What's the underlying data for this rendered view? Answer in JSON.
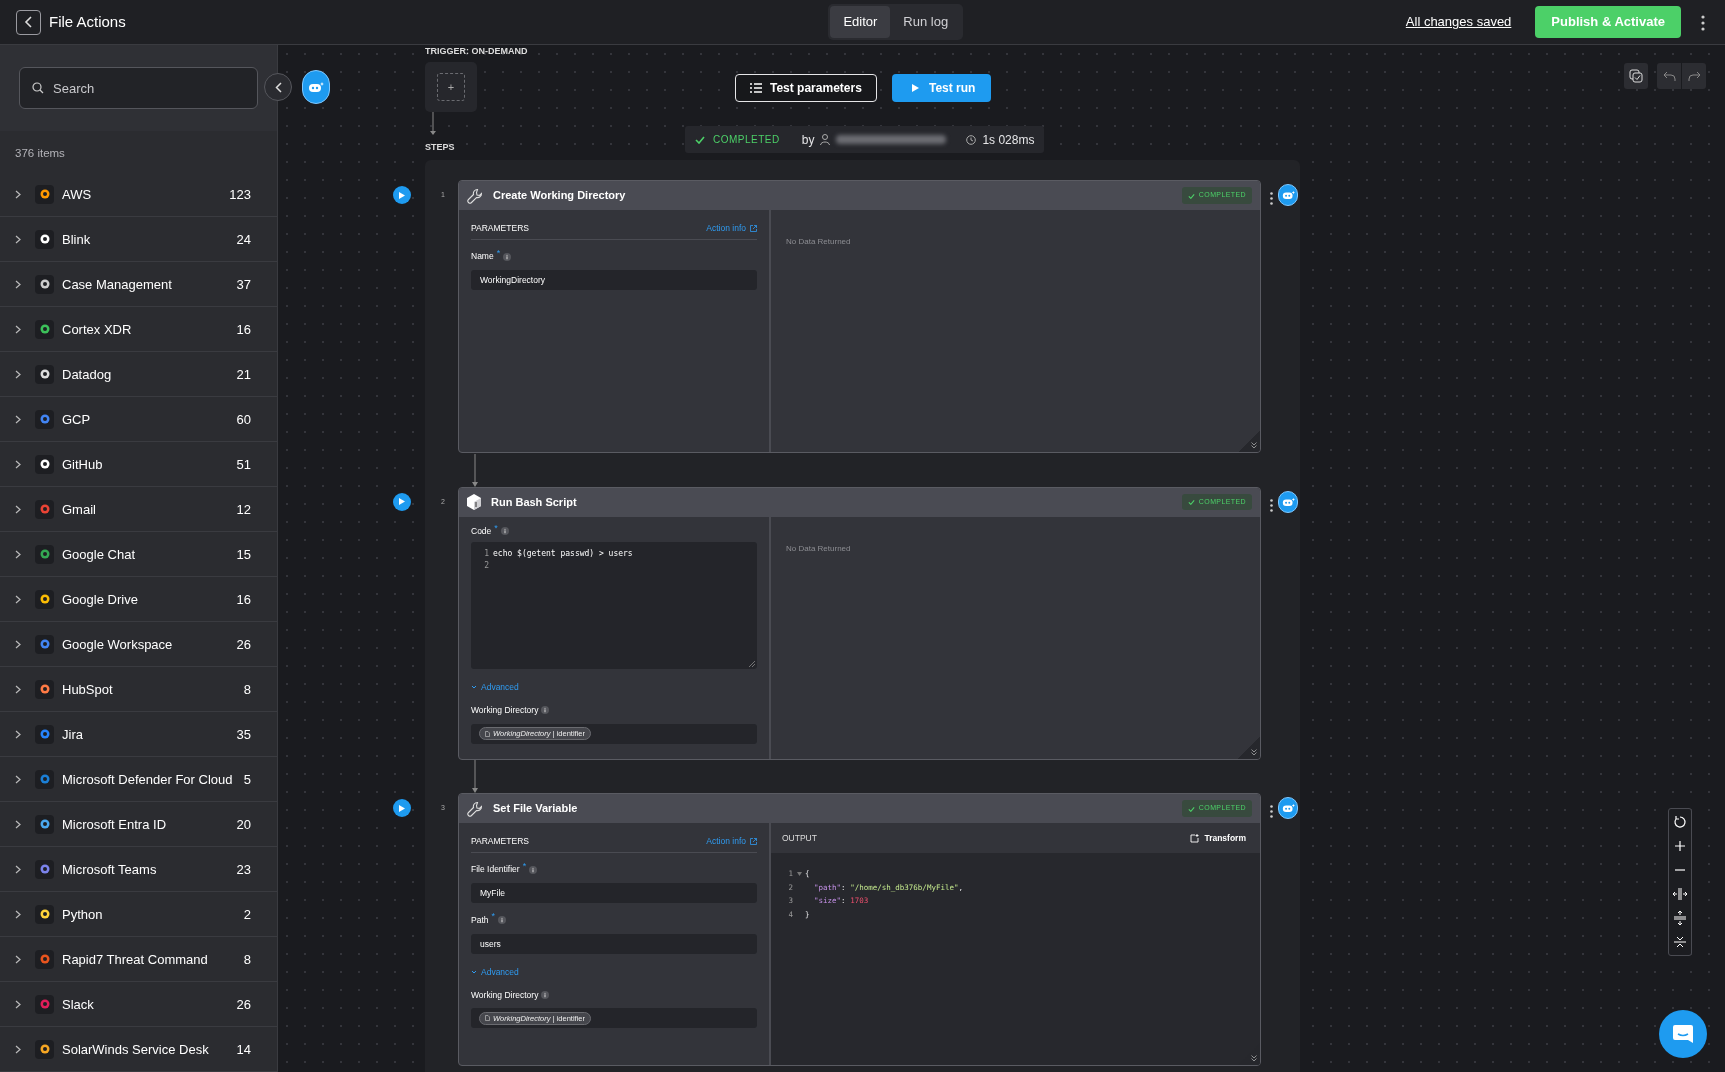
{
  "topbar": {
    "title": "File Actions",
    "tabs": [
      {
        "label": "Editor",
        "selected": true
      },
      {
        "label": "Run log",
        "selected": false
      }
    ],
    "save_status": "All changes saved",
    "publish_button": "Publish & Activate"
  },
  "sidebar": {
    "search": {
      "placeholder": "Search"
    },
    "count": "376 items",
    "items": [
      {
        "name": "AWS",
        "count": "123"
      },
      {
        "name": "Blink",
        "count": "24"
      },
      {
        "name": "Case Management",
        "count": "37"
      },
      {
        "name": "Cortex XDR",
        "count": "16"
      },
      {
        "name": "Datadog",
        "count": "21"
      },
      {
        "name": "GCP",
        "count": "60"
      },
      {
        "name": "GitHub",
        "count": "51"
      },
      {
        "name": "Gmail",
        "count": "12"
      },
      {
        "name": "Google Chat",
        "count": "15"
      },
      {
        "name": "Google Drive",
        "count": "16"
      },
      {
        "name": "Google Workspace",
        "count": "26"
      },
      {
        "name": "HubSpot",
        "count": "8"
      },
      {
        "name": "Jira",
        "count": "35"
      },
      {
        "name": "Microsoft Defender For Cloud",
        "count": "5"
      },
      {
        "name": "Microsoft Entra ID",
        "count": "20"
      },
      {
        "name": "Microsoft Teams",
        "count": "23"
      },
      {
        "name": "Python",
        "count": "2"
      },
      {
        "name": "Rapid7 Threat Command",
        "count": "8"
      },
      {
        "name": "Slack",
        "count": "26"
      },
      {
        "name": "SolarWinds Service Desk",
        "count": "14"
      }
    ]
  },
  "canvas": {
    "trigger_label": "TRIGGER: ON-DEMAND",
    "add_trigger": "+",
    "steps_label": "STEPS",
    "test_parameters_button": "Test parameters",
    "test_run_button": "Test run",
    "run_status": {
      "status": "COMPLETED",
      "by": "by",
      "duration": "1s 028ms"
    },
    "steps": [
      {
        "number": "1",
        "title": "Create Working Directory",
        "kind": "action",
        "status": "COMPLETED",
        "parameters": {
          "title": "PARAMETERS",
          "action_info": "Action info"
        },
        "fields": [
          {
            "kind": "text",
            "label": "Name",
            "required": "*",
            "value": "WorkingDirectory"
          }
        ],
        "output": {
          "kind": "empty",
          "text": "No Data Returned"
        }
      },
      {
        "number": "2",
        "title": "Run Bash Script",
        "kind": "script",
        "status": "COMPLETED",
        "fields": [
          {
            "kind": "code",
            "label": "Code",
            "required": "*",
            "lines": [
              {
                "num": "1",
                "text": "echo $(getent passwd) > users"
              },
              {
                "num": "2"
              }
            ]
          },
          {
            "kind": "toggle",
            "label": "Advanced",
            "expanded": true
          },
          {
            "kind": "chip",
            "label": "Working Directory",
            "chip": "*WorkingDirectory* | identifier"
          }
        ],
        "output": {
          "kind": "empty",
          "text": "No Data Returned"
        }
      },
      {
        "number": "3",
        "title": "Set File Variable",
        "kind": "action",
        "status": "COMPLETED",
        "parameters": {
          "title": "PARAMETERS",
          "action_info": "Action info"
        },
        "fields": [
          {
            "kind": "text",
            "label": "File Identifier",
            "required": "*",
            "value": "MyFile"
          },
          {
            "kind": "text",
            "label": "Path",
            "required": "*",
            "value": "users"
          },
          {
            "kind": "toggle",
            "label": "Advanced",
            "expanded": true
          },
          {
            "kind": "chip",
            "label": "Working Directory",
            "chip": "*WorkingDirectory* | identifier"
          }
        ],
        "output": {
          "kind": "json",
          "title": "OUTPUT",
          "transform_button": "Transform",
          "lines": [
            {
              "num": "1",
              "foldable": true,
              "tokens": [
                {
                  "kind": "punct",
                  "text": "{"
                }
              ]
            },
            {
              "num": "2",
              "indent": true,
              "tokens": [
                {
                  "kind": "key",
                  "text": "\"path\""
                },
                {
                  "kind": "punct",
                  "text": ": "
                },
                {
                  "kind": "string",
                  "text": "\"/home/sh_db376b/MyFile\""
                },
                {
                  "kind": "punct",
                  "text": ","
                }
              ]
            },
            {
              "num": "3",
              "indent": true,
              "tokens": [
                {
                  "kind": "key",
                  "text": "\"size\""
                },
                {
                  "kind": "punct",
                  "text": ": "
                },
                {
                  "kind": "number",
                  "text": "1703"
                }
              ]
            },
            {
              "num": "4",
              "tokens": [
                {
                  "kind": "punct",
                  "text": "}"
                }
              ]
            }
          ]
        }
      }
    ]
  }
}
